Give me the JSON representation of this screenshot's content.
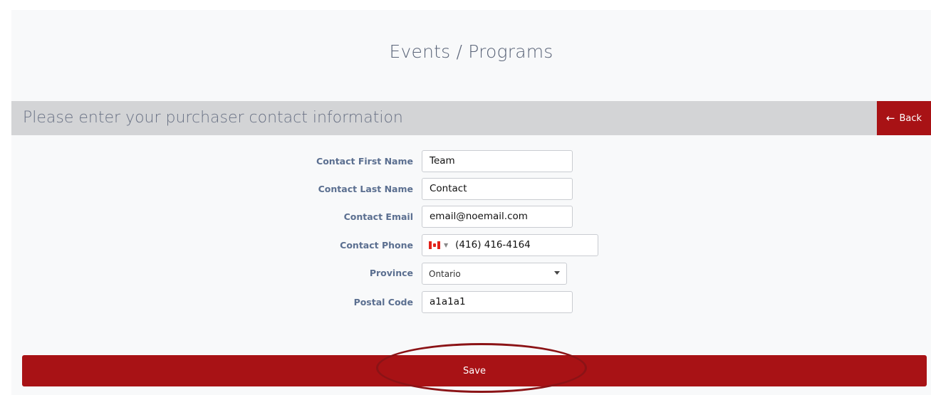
{
  "header": {
    "title": "Events / Programs"
  },
  "section": {
    "title": "Please enter your purchaser contact information",
    "back_label": "Back",
    "back_icon": "arrow-left-icon"
  },
  "form": {
    "first_name": {
      "label": "Contact First Name",
      "value": "Team"
    },
    "last_name": {
      "label": "Contact Last Name",
      "value": "Contact"
    },
    "email": {
      "label": "Contact Email",
      "value": "email@noemail.com"
    },
    "phone": {
      "label": "Contact Phone",
      "value": "(416) 416-4164",
      "country_icon": "canada-flag-icon"
    },
    "province": {
      "label": "Province",
      "selected": "Ontario"
    },
    "postal_code": {
      "label": "Postal Code",
      "value": "a1a1a1"
    }
  },
  "actions": {
    "save_label": "Save"
  },
  "colors": {
    "accent": "#a81215",
    "section_bar": "#d3d4d6",
    "label_text": "#5b6f90",
    "panel_background": "#f8f9fa"
  },
  "annotation": {
    "highlight": "circled-save-button"
  }
}
